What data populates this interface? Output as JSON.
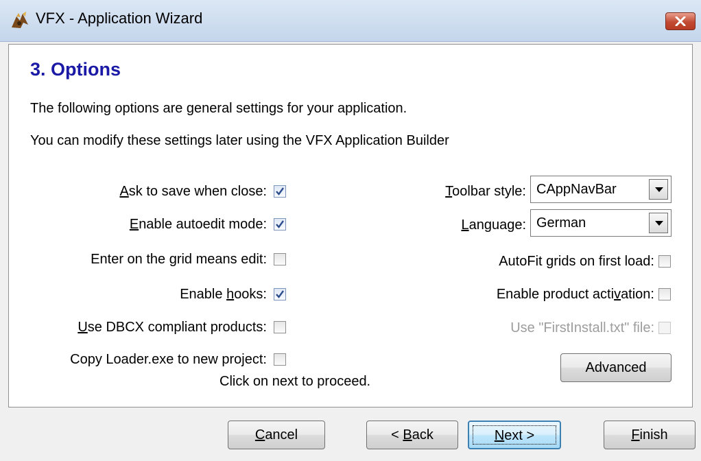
{
  "window": {
    "title": "VFX - Application Wizard",
    "app_icon": "vfx-app-icon",
    "close_icon": "close-x-icon"
  },
  "page": {
    "heading": "3. Options",
    "description_1": "The following options are general settings for your application.",
    "description_2": "You can modify these settings later using the VFX Application Builder",
    "hint": "Click on next to proceed."
  },
  "left_options": [
    {
      "pre": "",
      "u": "A",
      "post": "sk to save when close:",
      "checked": true
    },
    {
      "pre": "",
      "u": "E",
      "post": "nable autoedit mode:",
      "checked": true
    },
    {
      "pre": "Enter on the ",
      "u": "g",
      "post": "rid means edit:",
      "checked": false
    },
    {
      "pre": "Enable ",
      "u": "h",
      "post": "ooks:",
      "checked": true
    },
    {
      "pre": "",
      "u": "U",
      "post": "se DBCX compliant products:",
      "checked": false
    },
    {
      "pre": "Copy Loader.exe to new project:",
      "u": "",
      "post": "",
      "checked": false
    }
  ],
  "right_fields": {
    "toolbar_style": {
      "pre": "",
      "u": "T",
      "post": "oolbar style:",
      "value": "CAppNavBar"
    },
    "language": {
      "pre": "",
      "u": "L",
      "post": "anguage:",
      "value": "German"
    }
  },
  "right_options": [
    {
      "pre": "AutoFit  grids on first load:",
      "u": "",
      "post": "",
      "checked": false,
      "disabled": false
    },
    {
      "pre": "Enable  product acti",
      "u": "v",
      "post": "ation:",
      "checked": false,
      "disabled": false
    },
    {
      "pre": "Use \"FirstInstall.txt\" file:",
      "u": "",
      "post": "",
      "checked": false,
      "disabled": true
    }
  ],
  "buttons": {
    "advanced": "Advanced",
    "cancel": {
      "pre": "",
      "u": "C",
      "post": "ancel"
    },
    "back": {
      "pre": "< ",
      "u": "B",
      "post": "ack"
    },
    "next": {
      "pre": "",
      "u": "N",
      "post": "ext >"
    },
    "finish": {
      "pre": "",
      "u": "F",
      "post": "inish"
    }
  },
  "colors": {
    "heading": "#1a1aa6",
    "checkmark": "#2b4d8c",
    "default_button_border": "#3c7fb1"
  }
}
